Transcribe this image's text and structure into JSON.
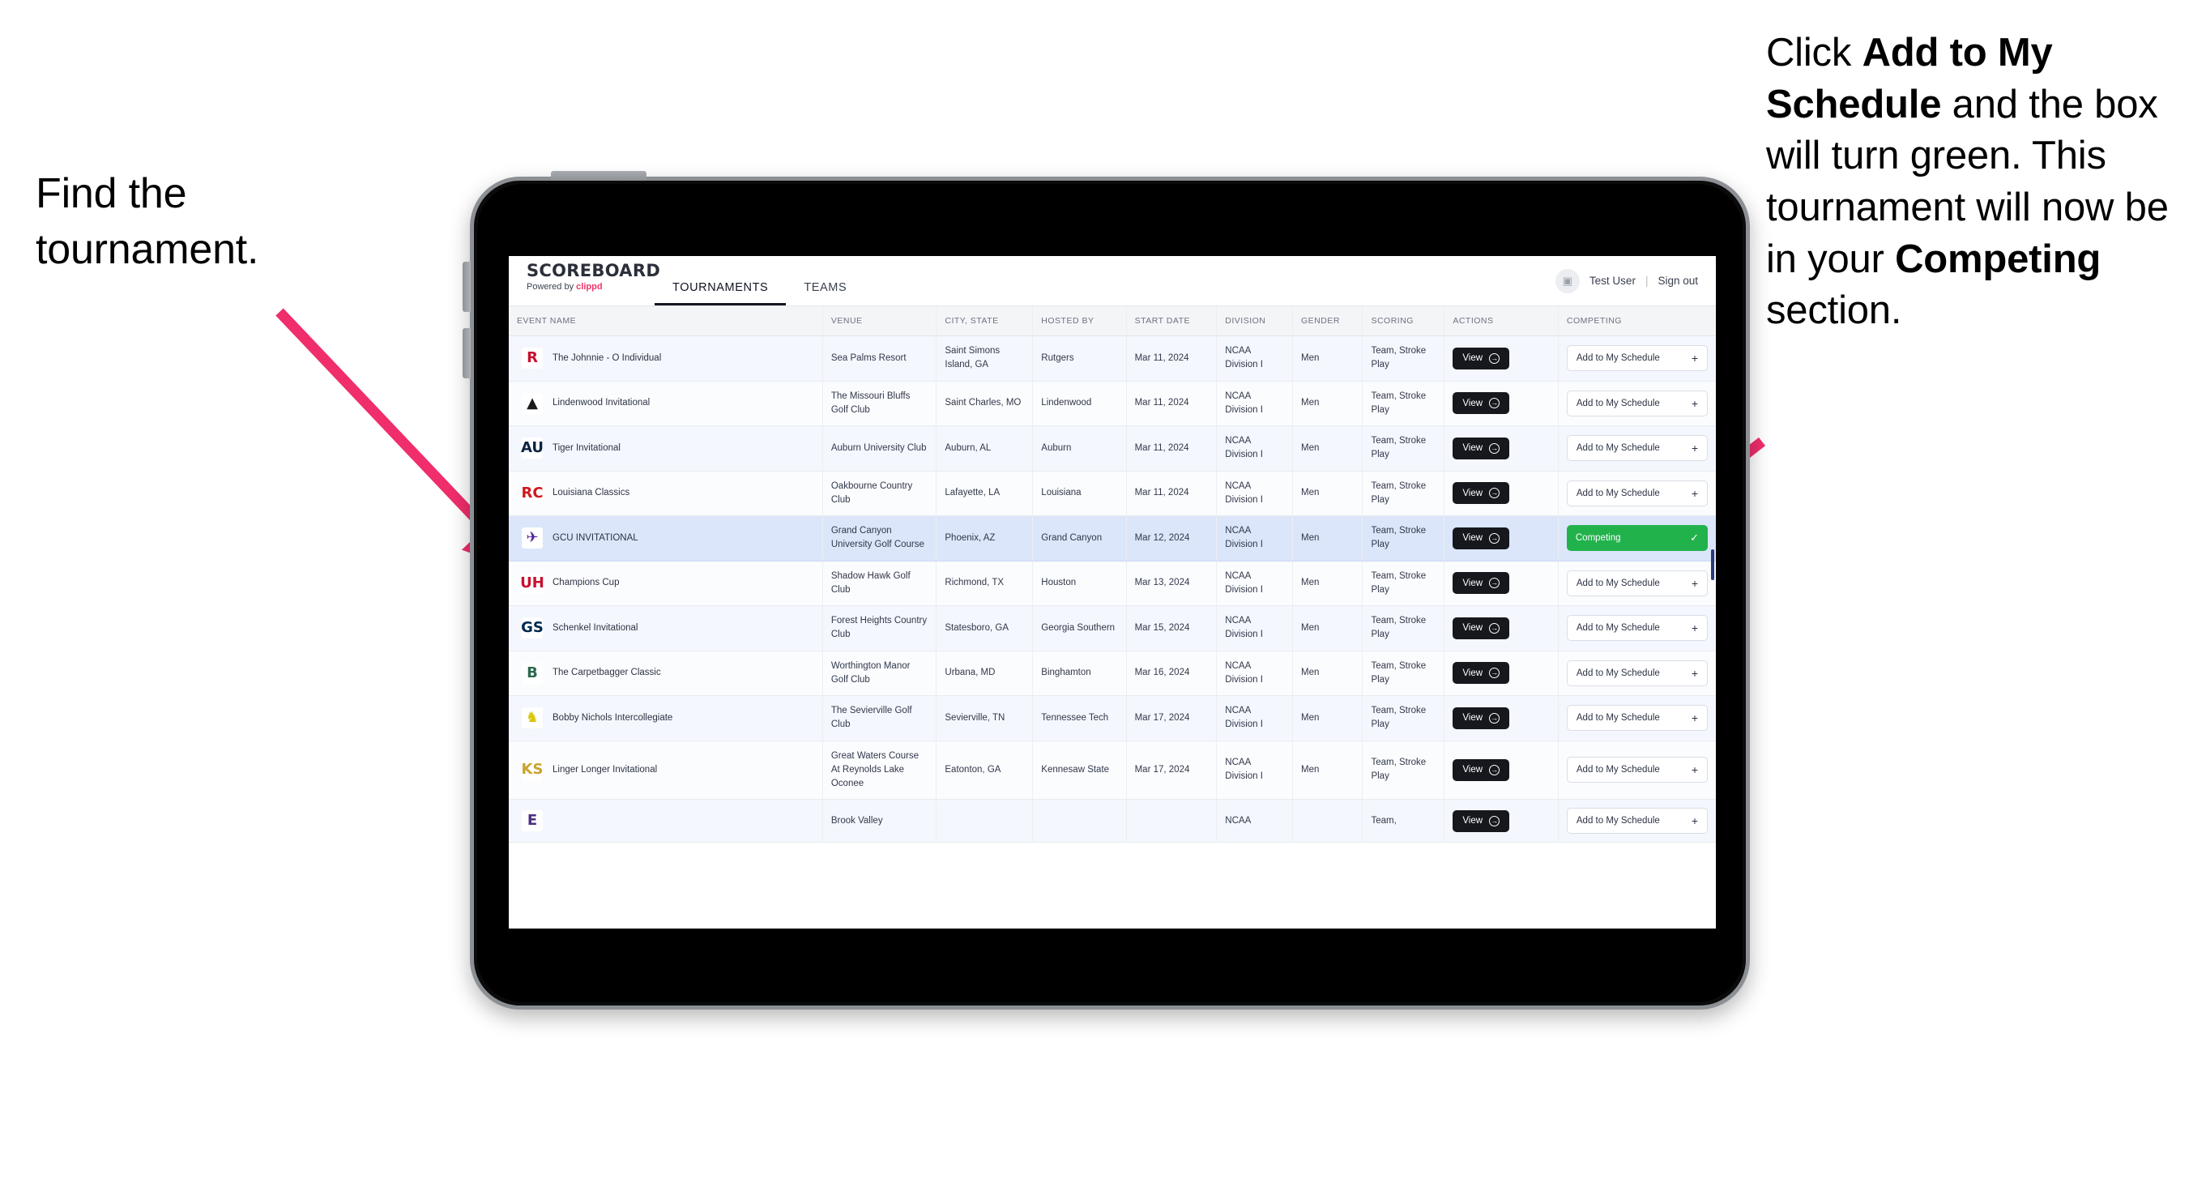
{
  "annotations": {
    "left": "Find the tournament.",
    "right_parts": [
      {
        "t": "Click ",
        "b": false
      },
      {
        "t": "Add to My Schedule",
        "b": true
      },
      {
        "t": " and the box will turn green. This tournament will now be in your ",
        "b": false
      },
      {
        "t": "Competing",
        "b": true
      },
      {
        "t": " section.",
        "b": false
      }
    ]
  },
  "app": {
    "brand": {
      "logo": "SCOREBOARD",
      "powered_prefix": "Powered by ",
      "powered_brand": "clippd"
    },
    "nav": [
      {
        "label": "TOURNAMENTS",
        "active": true
      },
      {
        "label": "TEAMS",
        "active": false
      }
    ],
    "user": {
      "avatar_icon": "user-badge-icon",
      "name": "Test User",
      "separator": "|",
      "signout": "Sign out"
    }
  },
  "table": {
    "headers": [
      "EVENT NAME",
      "VENUE",
      "CITY, STATE",
      "HOSTED BY",
      "START DATE",
      "DIVISION",
      "GENDER",
      "SCORING",
      "ACTIONS",
      "COMPETING"
    ],
    "view_label": "View",
    "add_label": "Add to My Schedule",
    "add_plus": "+",
    "competing_label": "Competing",
    "competing_check": "✓",
    "rows": [
      {
        "logo_text": "R",
        "logo_bg": "#ffffff",
        "logo_color": "#c8102e",
        "event": "The Johnnie - O Individual",
        "venue": "Sea Palms Resort",
        "city": "Saint Simons Island, GA",
        "host": "Rutgers",
        "date": "Mar 11, 2024",
        "division": "NCAA Division I",
        "gender": "Men",
        "scoring": "Team, Stroke Play",
        "competing": false
      },
      {
        "logo_text": "▲",
        "logo_bg": "#ffffff",
        "logo_color": "#1a1a1a",
        "event": "Lindenwood Invitational",
        "venue": "The Missouri Bluffs Golf Club",
        "city": "Saint Charles, MO",
        "host": "Lindenwood",
        "date": "Mar 11, 2024",
        "division": "NCAA Division I",
        "gender": "Men",
        "scoring": "Team, Stroke Play",
        "competing": false
      },
      {
        "logo_text": "AU",
        "logo_bg": "#ffffff",
        "logo_color": "#0c2340",
        "event": "Tiger Invitational",
        "venue": "Auburn University Club",
        "city": "Auburn, AL",
        "host": "Auburn",
        "date": "Mar 11, 2024",
        "division": "NCAA Division I",
        "gender": "Men",
        "scoring": "Team, Stroke Play",
        "competing": false
      },
      {
        "logo_text": "RC",
        "logo_bg": "#ffffff",
        "logo_color": "#ce181e",
        "event": "Louisiana Classics",
        "venue": "Oakbourne Country Club",
        "city": "Lafayette, LA",
        "host": "Louisiana",
        "date": "Mar 11, 2024",
        "division": "NCAA Division I",
        "gender": "Men",
        "scoring": "Team, Stroke Play",
        "competing": false
      },
      {
        "logo_text": "✈",
        "logo_bg": "#ffffff",
        "logo_color": "#522398",
        "event": "GCU INVITATIONAL",
        "venue": "Grand Canyon University Golf Course",
        "city": "Phoenix, AZ",
        "host": "Grand Canyon",
        "date": "Mar 12, 2024",
        "division": "NCAA Division I",
        "gender": "Men",
        "scoring": "Team, Stroke Play",
        "competing": true
      },
      {
        "logo_text": "UH",
        "logo_bg": "#ffffff",
        "logo_color": "#c8102e",
        "event": "Champions Cup",
        "venue": "Shadow Hawk Golf Club",
        "city": "Richmond, TX",
        "host": "Houston",
        "date": "Mar 13, 2024",
        "division": "NCAA Division I",
        "gender": "Men",
        "scoring": "Team, Stroke Play",
        "competing": false
      },
      {
        "logo_text": "GS",
        "logo_bg": "#ffffff",
        "logo_color": "#00274c",
        "event": "Schenkel Invitational",
        "venue": "Forest Heights Country Club",
        "city": "Statesboro, GA",
        "host": "Georgia Southern",
        "date": "Mar 15, 2024",
        "division": "NCAA Division I",
        "gender": "Men",
        "scoring": "Team, Stroke Play",
        "competing": false
      },
      {
        "logo_text": "B",
        "logo_bg": "#ffffff",
        "logo_color": "#2a6a4f",
        "event": "The Carpetbagger Classic",
        "venue": "Worthington Manor Golf Club",
        "city": "Urbana, MD",
        "host": "Binghamton",
        "date": "Mar 16, 2024",
        "division": "NCAA Division I",
        "gender": "Men",
        "scoring": "Team, Stroke Play",
        "competing": false
      },
      {
        "logo_text": "♞",
        "logo_bg": "#ffffff",
        "logo_color": "#d8c500",
        "event": "Bobby Nichols Intercollegiate",
        "venue": "The Sevierville Golf Club",
        "city": "Sevierville, TN",
        "host": "Tennessee Tech",
        "date": "Mar 17, 2024",
        "division": "NCAA Division I",
        "gender": "Men",
        "scoring": "Team, Stroke Play",
        "competing": false
      },
      {
        "logo_text": "KS",
        "logo_bg": "#ffffff",
        "logo_color": "#c8a42c",
        "event": "Linger Longer Invitational",
        "venue": "Great Waters Course At Reynolds Lake Oconee",
        "city": "Eatonton, GA",
        "host": "Kennesaw State",
        "date": "Mar 17, 2024",
        "division": "NCAA Division I",
        "gender": "Men",
        "scoring": "Team, Stroke Play",
        "competing": false
      },
      {
        "logo_text": "E",
        "logo_bg": "#ffffff",
        "logo_color": "#4b2e83",
        "event": "",
        "venue": "Brook Valley",
        "city": "",
        "host": "",
        "date": "",
        "division": "NCAA",
        "gender": "",
        "scoring": "Team,",
        "competing": false
      }
    ]
  },
  "colors": {
    "accent_green": "#22b24c",
    "arrow_pink": "#ef2e6b",
    "row_selected": "#dbe6fa",
    "dark_button": "#16181d",
    "brand_pink": "#f0326a"
  }
}
